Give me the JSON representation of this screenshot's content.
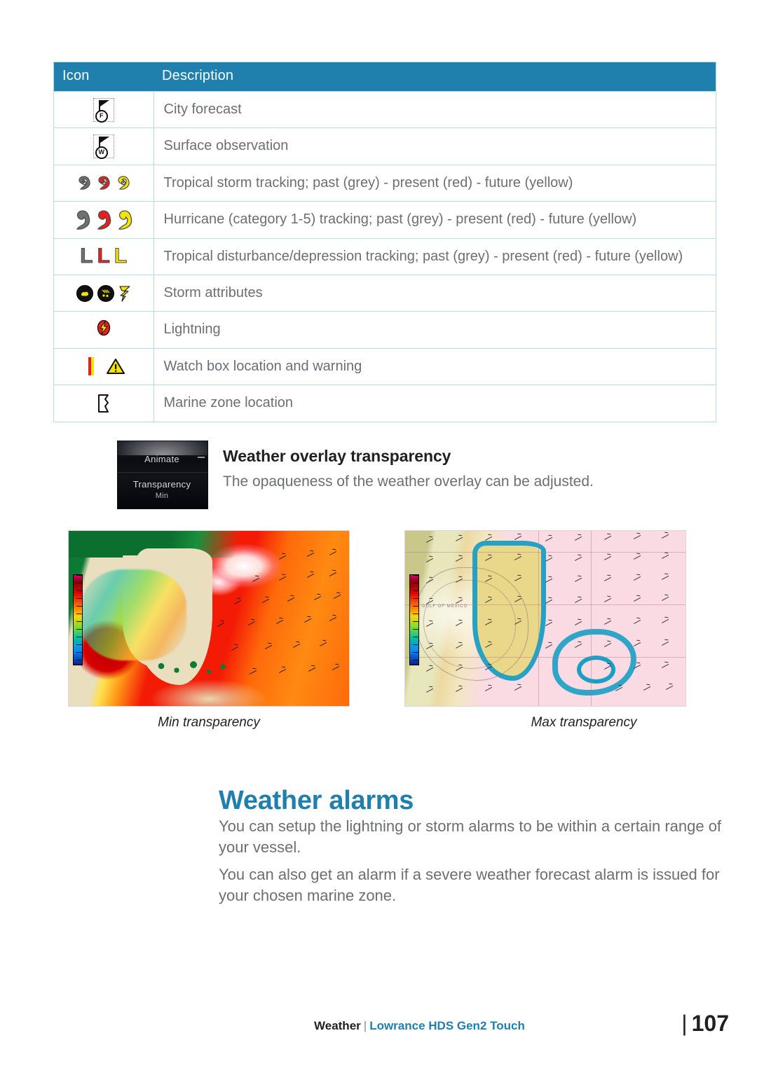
{
  "table": {
    "headers": [
      "Icon",
      "Description"
    ],
    "rows": [
      {
        "icon": "city-forecast-icon",
        "letter": "F",
        "description": "City forecast"
      },
      {
        "icon": "surface-observation-icon",
        "letter": "W",
        "description": "Surface observation"
      },
      {
        "icon": "tropical-storm-tracking-icons",
        "description": "Tropical storm tracking; past (grey) - present (red) - future (yellow)"
      },
      {
        "icon": "hurricane-tracking-icons",
        "description": "Hurricane (category 1-5) tracking;  past (grey) - present (red) - future (yellow)"
      },
      {
        "icon": "tropical-depression-tracking-icons",
        "description": "Tropical disturbance/depression tracking;  past (grey) - present (red) - future (yellow)"
      },
      {
        "icon": "storm-attributes-icons",
        "description": "Storm attributes"
      },
      {
        "icon": "lightning-icon",
        "description": "Lightning"
      },
      {
        "icon": "watch-box-warning-icons",
        "description": "Watch box location and warning"
      },
      {
        "icon": "marine-zone-icon",
        "description": "Marine zone location"
      }
    ]
  },
  "overlay_section": {
    "title": "Weather overlay transparency",
    "body": "The opaqueness of the weather overlay can be adjusted.",
    "panel": {
      "animate_label": "Animate",
      "transparency_label": "Transparency",
      "transparency_value": "Min"
    }
  },
  "figures": [
    {
      "caption": "Min transparency"
    },
    {
      "caption": "Max transparency"
    }
  ],
  "alarms": {
    "heading": "Weather alarms",
    "paragraph1": "You can setup the lightning or storm alarms to be within a certain range of your vessel.",
    "paragraph2": "You can also get an alarm if a severe weather forecast alarm is issued for your chosen marine zone."
  },
  "footer": {
    "section": "Weather",
    "separator": "|",
    "product": "Lowrance HDS Gen2 Touch",
    "page_bar": "|",
    "page_number": "107"
  },
  "colors": {
    "accent_blue": "#1f7fad",
    "table_border": "#b9dbe6",
    "body_text": "#6d6e71",
    "storm_grey": "#6f7072",
    "storm_red": "#e8201a",
    "storm_yellow": "#f2e400"
  }
}
